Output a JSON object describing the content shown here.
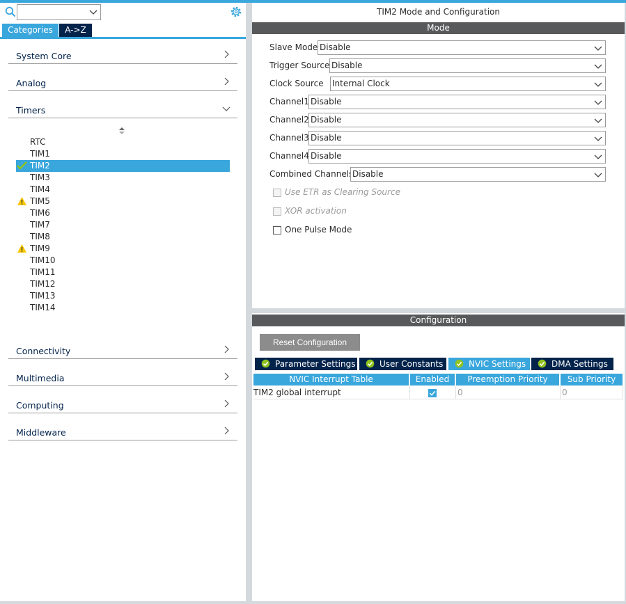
{
  "left": {
    "tabs": {
      "categories": "Categories",
      "az": "A->Z"
    },
    "categories": {
      "system_core": "System Core",
      "analog": "Analog",
      "timers": "Timers",
      "connectivity": "Connectivity",
      "multimedia": "Multimedia",
      "computing": "Computing",
      "middleware": "Middleware"
    },
    "timers": [
      "RTC",
      "TIM1",
      "TIM2",
      "TIM3",
      "TIM4",
      "TIM5",
      "TIM6",
      "TIM7",
      "TIM8",
      "TIM9",
      "TIM10",
      "TIM11",
      "TIM12",
      "TIM13",
      "TIM14"
    ],
    "selected_timer": "TIM2"
  },
  "mode": {
    "title": "TIM2 Mode and Configuration",
    "section": "Mode",
    "fields": {
      "slave_mode": {
        "label": "Slave Mode",
        "value": "Disable"
      },
      "trigger_source": {
        "label": "Trigger Source",
        "value": "Disable"
      },
      "clock_source": {
        "label": "Clock Source",
        "value": "Internal Clock"
      },
      "channel1": {
        "label": "Channel1",
        "value": "Disable"
      },
      "channel2": {
        "label": "Channel2",
        "value": "Disable"
      },
      "channel3": {
        "label": "Channel3",
        "value": "Disable"
      },
      "channel4": {
        "label": "Channel4",
        "value": "Disable"
      },
      "combined_channels": {
        "label": "Combined Channels",
        "value": "Disable"
      }
    },
    "checkboxes": {
      "etr": "Use ETR as Clearing Source",
      "xor": "XOR activation",
      "one_pulse": "One Pulse Mode"
    }
  },
  "config": {
    "section": "Configuration",
    "reset_label": "Reset Configuration",
    "tabs": {
      "parameter": "Parameter Settings",
      "user_constants": "User Constants",
      "nvic": "NVIC Settings",
      "dma": "DMA Settings"
    },
    "table": {
      "headers": {
        "interrupt": "NVIC Interrupt Table",
        "enabled": "Enabled",
        "preemption": "Preemption Priority",
        "sub": "Sub Priority"
      },
      "row": {
        "name": "TIM2 global interrupt",
        "preemption": "0",
        "sub": "0"
      }
    }
  },
  "colors": {
    "accent": "#39a6dc",
    "navy": "#03234b",
    "section": "#58595b",
    "ok": "#8fc31f",
    "warn": "#f7c600"
  }
}
